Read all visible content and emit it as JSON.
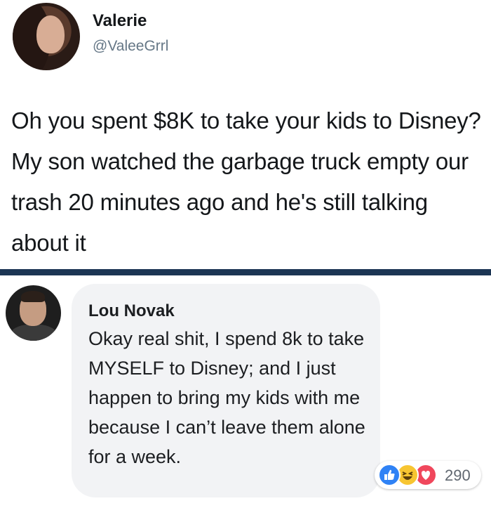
{
  "tweet": {
    "author_name": "Valerie",
    "author_handle": "@ValeeGrrl",
    "text": "Oh you spent $8K to take your kids to Disney? My son watched the garbage truck empty our trash 20 minutes ago and he's still talking about it"
  },
  "comment": {
    "author_name": "Lou Novak",
    "text": "Okay real shit, I spend 8k to take MYSELF to Disney; and I just happen to bring my kids with me because I can’t leave them alone for a week.",
    "reactions": {
      "icons": [
        "like-icon",
        "haha-icon",
        "love-icon"
      ],
      "count": "290"
    }
  },
  "colors": {
    "divider": "#1c3554",
    "bubble": "#f2f3f5",
    "like": "#2f82f5",
    "haha": "#f7c531",
    "love": "#f0475c"
  }
}
